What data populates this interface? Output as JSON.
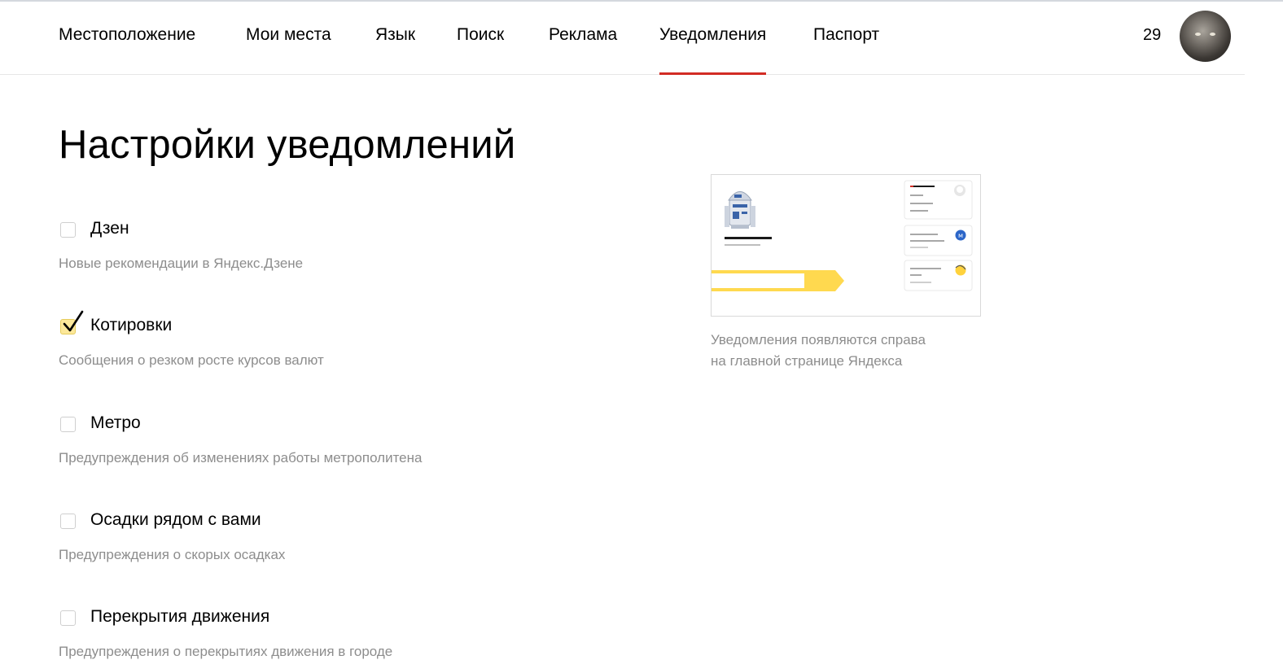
{
  "nav": {
    "tabs": [
      {
        "label": "Местоположение"
      },
      {
        "label": "Мои места"
      },
      {
        "label": "Язык"
      },
      {
        "label": "Поиск"
      },
      {
        "label": "Реклама"
      },
      {
        "label": "Уведомления",
        "active": true
      },
      {
        "label": "Паспорт"
      }
    ],
    "counter": "29"
  },
  "page": {
    "title": "Настройки уведомлений"
  },
  "settings": {
    "items": [
      {
        "label": "Дзен",
        "description": "Новые рекомендации в Яндекс.Дзене",
        "checked": false
      },
      {
        "label": "Котировки",
        "description": "Сообщения о резком росте курсов валют",
        "checked": true
      },
      {
        "label": "Метро",
        "description": "Предупреждения об изменениях работы метрополитена",
        "checked": false
      },
      {
        "label": "Осадки рядом с вами",
        "description": "Предупреждения о скорых осадках",
        "checked": false
      },
      {
        "label": "Перекрытия движения",
        "description": "Предупреждения о перекрытиях движения в городе",
        "checked": false
      }
    ]
  },
  "preview": {
    "caption_line1": "Уведомления появляются справа",
    "caption_line2": "на главной странице Яндекса"
  },
  "colors": {
    "accent_red": "#d22c24",
    "checkbox_checked": "#fce89a",
    "yellow": "#ffd94f",
    "secondary_text": "#8d8d8d",
    "metro_blue": "#2c66c8"
  }
}
